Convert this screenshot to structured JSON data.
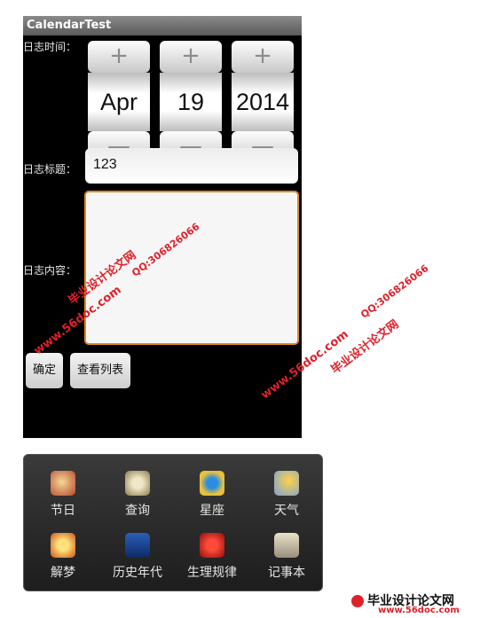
{
  "app": {
    "title": "CalendarTest"
  },
  "labels": {
    "date": "日志时间：",
    "title": "日志标题：",
    "content": "日志内容："
  },
  "pickers": [
    {
      "name": "month",
      "value": "Apr",
      "plus": "+",
      "minus": "—"
    },
    {
      "name": "day",
      "value": "19",
      "plus": "+",
      "minus": "—"
    },
    {
      "name": "year",
      "value": "2014",
      "plus": "+",
      "minus": "—"
    }
  ],
  "fields": {
    "title_value": "123",
    "content_value": ""
  },
  "buttons": {
    "confirm": "确定",
    "view_list": "查看列表"
  },
  "menu": {
    "items": [
      {
        "label": "节日",
        "icon": "festival-icon"
      },
      {
        "label": "查询",
        "icon": "query-icon"
      },
      {
        "label": "星座",
        "icon": "constellation-icon"
      },
      {
        "label": "天气",
        "icon": "weather-icon"
      },
      {
        "label": "解梦",
        "icon": "dream-icon"
      },
      {
        "label": "历史年代",
        "icon": "history-icon"
      },
      {
        "label": "生理规律",
        "icon": "physiology-icon"
      },
      {
        "label": "记事本",
        "icon": "notebook-icon"
      }
    ]
  },
  "watermark": {
    "site": "毕业设计论文网",
    "url": "www.56doc.com",
    "qq": "QQ:306826066"
  },
  "colors": {
    "accent": "#e08a1e",
    "watermark_red": "#e0202a",
    "watermark_blue": "#1b2db0"
  }
}
